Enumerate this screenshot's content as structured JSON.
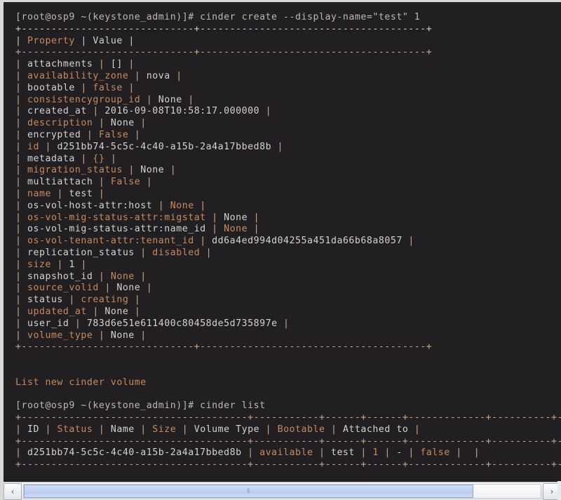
{
  "terminal": {
    "colors": {
      "background": "#211f22",
      "foreground": "#d6d2cf",
      "highlight": "#c88a5e",
      "rule": "#c9a88a",
      "frame": "#d8d8d8"
    },
    "lines": [
      {
        "segments": [
          {
            "t": "[root@osp9 ~(keystone_admin)]# cinder create --display-name=\"test\" 1",
            "c": "p"
          }
        ]
      },
      {
        "segments": [
          {
            "t": "+-----------------------------+--------------------------------------+",
            "c": "rw"
          }
        ]
      },
      {
        "segments": [
          {
            "t": "| ",
            "c": "rw"
          },
          {
            "t": "Property",
            "c": "o"
          },
          {
            "t": " | ",
            "c": "rw"
          },
          {
            "t": "Value",
            "c": "w"
          },
          {
            "t": " |",
            "c": "rw"
          }
        ]
      },
      {
        "segments": [
          {
            "t": "+-----------------------------+--------------------------------------+",
            "c": "r"
          }
        ]
      },
      {
        "segments": [
          {
            "t": "| ",
            "c": "r"
          },
          {
            "t": "attachments",
            "c": "w"
          },
          {
            "t": " | ",
            "c": "r"
          },
          {
            "t": "[]",
            "c": "w"
          },
          {
            "t": " |",
            "c": "r"
          }
        ]
      },
      {
        "segments": [
          {
            "t": "| ",
            "c": "r"
          },
          {
            "t": "availability_zone",
            "c": "o"
          },
          {
            "t": " | ",
            "c": "r"
          },
          {
            "t": "nova",
            "c": "w"
          },
          {
            "t": " |",
            "c": "r"
          }
        ]
      },
      {
        "segments": [
          {
            "t": "| ",
            "c": "r"
          },
          {
            "t": "bootable",
            "c": "w"
          },
          {
            "t": " | ",
            "c": "r"
          },
          {
            "t": "false",
            "c": "o"
          },
          {
            "t": " |",
            "c": "r"
          }
        ]
      },
      {
        "segments": [
          {
            "t": "| ",
            "c": "r"
          },
          {
            "t": "consistencygroup_id",
            "c": "o"
          },
          {
            "t": " | ",
            "c": "r"
          },
          {
            "t": "None",
            "c": "w"
          },
          {
            "t": " |",
            "c": "r"
          }
        ]
      },
      {
        "segments": [
          {
            "t": "| ",
            "c": "r"
          },
          {
            "t": "created_at",
            "c": "w"
          },
          {
            "t": " | ",
            "c": "r"
          },
          {
            "t": "2016-09-08T10:58:17.000000",
            "c": "w"
          },
          {
            "t": " |",
            "c": "r"
          }
        ]
      },
      {
        "segments": [
          {
            "t": "| ",
            "c": "r"
          },
          {
            "t": "description",
            "c": "o"
          },
          {
            "t": " | ",
            "c": "r"
          },
          {
            "t": "None",
            "c": "w"
          },
          {
            "t": " |",
            "c": "r"
          }
        ]
      },
      {
        "segments": [
          {
            "t": "| ",
            "c": "r"
          },
          {
            "t": "encrypted",
            "c": "w"
          },
          {
            "t": " | ",
            "c": "r"
          },
          {
            "t": "False",
            "c": "o"
          },
          {
            "t": " |",
            "c": "r"
          }
        ]
      },
      {
        "segments": [
          {
            "t": "| ",
            "c": "r"
          },
          {
            "t": "id",
            "c": "o"
          },
          {
            "t": " | ",
            "c": "r"
          },
          {
            "t": "d251bb74-5c5c-4c40-a15b-2a4a17bbed8b",
            "c": "w"
          },
          {
            "t": " |",
            "c": "r"
          }
        ]
      },
      {
        "segments": [
          {
            "t": "| ",
            "c": "r"
          },
          {
            "t": "metadata",
            "c": "w"
          },
          {
            "t": " | ",
            "c": "r"
          },
          {
            "t": "{}",
            "c": "o"
          },
          {
            "t": " |",
            "c": "r"
          }
        ]
      },
      {
        "segments": [
          {
            "t": "| ",
            "c": "r"
          },
          {
            "t": "migration_status",
            "c": "o"
          },
          {
            "t": " | ",
            "c": "r"
          },
          {
            "t": "None",
            "c": "w"
          },
          {
            "t": " |",
            "c": "r"
          }
        ]
      },
      {
        "segments": [
          {
            "t": "| ",
            "c": "r"
          },
          {
            "t": "multiattach",
            "c": "w"
          },
          {
            "t": " | ",
            "c": "r"
          },
          {
            "t": "False",
            "c": "o"
          },
          {
            "t": " |",
            "c": "r"
          }
        ]
      },
      {
        "segments": [
          {
            "t": "| ",
            "c": "r"
          },
          {
            "t": "name",
            "c": "o"
          },
          {
            "t": " | ",
            "c": "r"
          },
          {
            "t": "test",
            "c": "w"
          },
          {
            "t": " |",
            "c": "r"
          }
        ]
      },
      {
        "segments": [
          {
            "t": "| ",
            "c": "r"
          },
          {
            "t": "os-vol-host-attr:host",
            "c": "w"
          },
          {
            "t": " | ",
            "c": "r"
          },
          {
            "t": "None",
            "c": "o"
          },
          {
            "t": " |",
            "c": "r"
          }
        ]
      },
      {
        "segments": [
          {
            "t": "| ",
            "c": "r"
          },
          {
            "t": "os-vol-mig-status-attr:migstat",
            "c": "o"
          },
          {
            "t": " | ",
            "c": "r"
          },
          {
            "t": "None",
            "c": "w"
          },
          {
            "t": " |",
            "c": "r"
          }
        ]
      },
      {
        "segments": [
          {
            "t": "| ",
            "c": "r"
          },
          {
            "t": "os-vol-mig-status-attr:name_id",
            "c": "w"
          },
          {
            "t": " | ",
            "c": "r"
          },
          {
            "t": "None",
            "c": "o"
          },
          {
            "t": " |",
            "c": "r"
          }
        ]
      },
      {
        "segments": [
          {
            "t": "| ",
            "c": "r"
          },
          {
            "t": "os-vol-tenant-attr:tenant_id",
            "c": "o"
          },
          {
            "t": " | ",
            "c": "r"
          },
          {
            "t": "dd6a4ed994d04255a451da66b68a8057",
            "c": "w"
          },
          {
            "t": " |",
            "c": "r"
          }
        ]
      },
      {
        "segments": [
          {
            "t": "| ",
            "c": "r"
          },
          {
            "t": "replication_status",
            "c": "w"
          },
          {
            "t": " | ",
            "c": "r"
          },
          {
            "t": "disabled",
            "c": "o"
          },
          {
            "t": " |",
            "c": "r"
          }
        ]
      },
      {
        "segments": [
          {
            "t": "| ",
            "c": "r"
          },
          {
            "t": "size",
            "c": "o"
          },
          {
            "t": " | ",
            "c": "r"
          },
          {
            "t": "1",
            "c": "w"
          },
          {
            "t": " |",
            "c": "r"
          }
        ]
      },
      {
        "segments": [
          {
            "t": "| ",
            "c": "r"
          },
          {
            "t": "snapshot_id",
            "c": "w"
          },
          {
            "t": " | ",
            "c": "r"
          },
          {
            "t": "None",
            "c": "o"
          },
          {
            "t": " |",
            "c": "r"
          }
        ]
      },
      {
        "segments": [
          {
            "t": "| ",
            "c": "r"
          },
          {
            "t": "source_volid",
            "c": "o"
          },
          {
            "t": " | ",
            "c": "r"
          },
          {
            "t": "None",
            "c": "w"
          },
          {
            "t": " |",
            "c": "r"
          }
        ]
      },
      {
        "segments": [
          {
            "t": "| ",
            "c": "r"
          },
          {
            "t": "status",
            "c": "w"
          },
          {
            "t": " | ",
            "c": "r"
          },
          {
            "t": "creating",
            "c": "o"
          },
          {
            "t": " |",
            "c": "r"
          }
        ]
      },
      {
        "segments": [
          {
            "t": "| ",
            "c": "r"
          },
          {
            "t": "updated_at",
            "c": "o"
          },
          {
            "t": " | ",
            "c": "r"
          },
          {
            "t": "None",
            "c": "w"
          },
          {
            "t": " |",
            "c": "r"
          }
        ]
      },
      {
        "segments": [
          {
            "t": "| ",
            "c": "r"
          },
          {
            "t": "user_id",
            "c": "w"
          },
          {
            "t": " | ",
            "c": "r"
          },
          {
            "t": "783d6e51e611400c80458de5d735897e",
            "c": "w"
          },
          {
            "t": " |",
            "c": "r"
          }
        ]
      },
      {
        "segments": [
          {
            "t": "| ",
            "c": "r"
          },
          {
            "t": "volume_type",
            "c": "o"
          },
          {
            "t": " | ",
            "c": "r"
          },
          {
            "t": "None",
            "c": "w"
          },
          {
            "t": " |",
            "c": "r"
          }
        ]
      },
      {
        "segments": [
          {
            "t": "+-----------------------------+--------------------------------------+",
            "c": "r"
          }
        ]
      },
      {
        "segments": []
      },
      {
        "segments": []
      },
      {
        "segments": [
          {
            "t": "List new cinder volume",
            "c": "o"
          }
        ]
      },
      {
        "segments": []
      },
      {
        "segments": [
          {
            "t": "[root@osp9 ~(keystone_admin)]# cinder list",
            "c": "p"
          }
        ]
      },
      {
        "segments": [
          {
            "t": "+--------------------------------------+-----------+------+------+-------------+----------+-------------+",
            "c": "r"
          }
        ]
      },
      {
        "segments": [
          {
            "t": "| ",
            "c": "r"
          },
          {
            "t": "ID",
            "c": "w"
          },
          {
            "t": " | ",
            "c": "r"
          },
          {
            "t": "Status",
            "c": "o"
          },
          {
            "t": " | ",
            "c": "r"
          },
          {
            "t": "Name",
            "c": "w"
          },
          {
            "t": " | ",
            "c": "r"
          },
          {
            "t": "Size",
            "c": "o"
          },
          {
            "t": " | ",
            "c": "r"
          },
          {
            "t": "Volume Type",
            "c": "w"
          },
          {
            "t": " | ",
            "c": "r"
          },
          {
            "t": "Bootable",
            "c": "o"
          },
          {
            "t": " | ",
            "c": "r"
          },
          {
            "t": "Attached to",
            "c": "w"
          },
          {
            "t": " |",
            "c": "r"
          }
        ]
      },
      {
        "segments": [
          {
            "t": "+--------------------------------------+-----------+------+------+-------------+----------+-------------+",
            "c": "r"
          }
        ]
      },
      {
        "segments": [
          {
            "t": "| ",
            "c": "r"
          },
          {
            "t": "d251bb74-5c5c-4c40-a15b-2a4a17bbed8b",
            "c": "w"
          },
          {
            "t": " | ",
            "c": "r"
          },
          {
            "t": "available",
            "c": "o"
          },
          {
            "t": " | ",
            "c": "r"
          },
          {
            "t": "test",
            "c": "w"
          },
          {
            "t": " | ",
            "c": "r"
          },
          {
            "t": "1",
            "c": "o"
          },
          {
            "t": " | ",
            "c": "r"
          },
          {
            "t": "-",
            "c": "w"
          },
          {
            "t": " | ",
            "c": "r"
          },
          {
            "t": "false",
            "c": "o"
          },
          {
            "t": " | ",
            "c": "r"
          },
          {
            "t": " |",
            "c": "r"
          }
        ]
      },
      {
        "segments": [
          {
            "t": "+--------------------------------------+-----------+------+------+-------------+----------+-------------+",
            "c": "r"
          }
        ]
      }
    ]
  },
  "scrollbar": {
    "left_arrow": "‹",
    "right_arrow": "›",
    "grip": "⦀",
    "thumb_width_pct": "87%"
  }
}
